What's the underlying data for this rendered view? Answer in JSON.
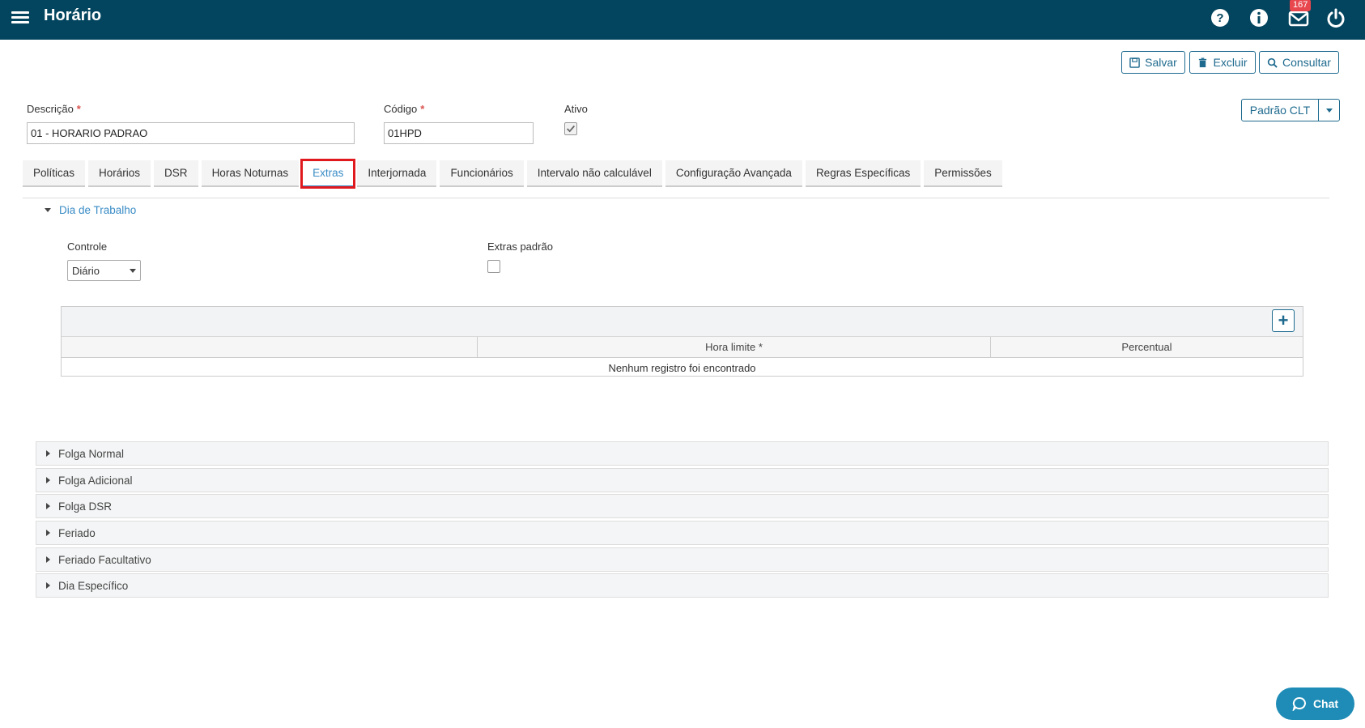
{
  "header": {
    "title": "Horário",
    "mail_count": "167",
    "bg_color": "#03455e"
  },
  "actions": {
    "save": "Salvar",
    "delete": "Excluir",
    "search": "Consultar",
    "padrao": "Padrão CLT"
  },
  "form": {
    "descricao_label": "Descrição",
    "descricao_value": "01 - HORARIO PADRAO",
    "codigo_label": "Código",
    "codigo_value": "01HPD",
    "ativo_label": "Ativo"
  },
  "tabs": [
    {
      "label": "Políticas"
    },
    {
      "label": "Horários"
    },
    {
      "label": "DSR"
    },
    {
      "label": "Horas Noturnas"
    },
    {
      "label": "Extras"
    },
    {
      "label": "Interjornada"
    },
    {
      "label": "Funcionários"
    },
    {
      "label": "Intervalo não calculável"
    },
    {
      "label": "Configuração Avançada"
    },
    {
      "label": "Regras Específicas"
    },
    {
      "label": "Permissões"
    }
  ],
  "dia_trabalho": {
    "title": "Dia de Trabalho",
    "controle_label": "Controle",
    "controle_value": "Diário",
    "extras_padrao_label": "Extras padrão"
  },
  "grid": {
    "col_hora": "Hora limite *",
    "col_percentual": "Percentual",
    "empty": "Nenhum registro foi encontrado"
  },
  "sections": [
    {
      "label": "Folga Normal"
    },
    {
      "label": "Folga Adicional"
    },
    {
      "label": "Folga DSR"
    },
    {
      "label": "Feriado"
    },
    {
      "label": "Feriado Facultativo"
    },
    {
      "label": "Dia Específico"
    }
  ],
  "chat": {
    "label": "Chat"
  }
}
